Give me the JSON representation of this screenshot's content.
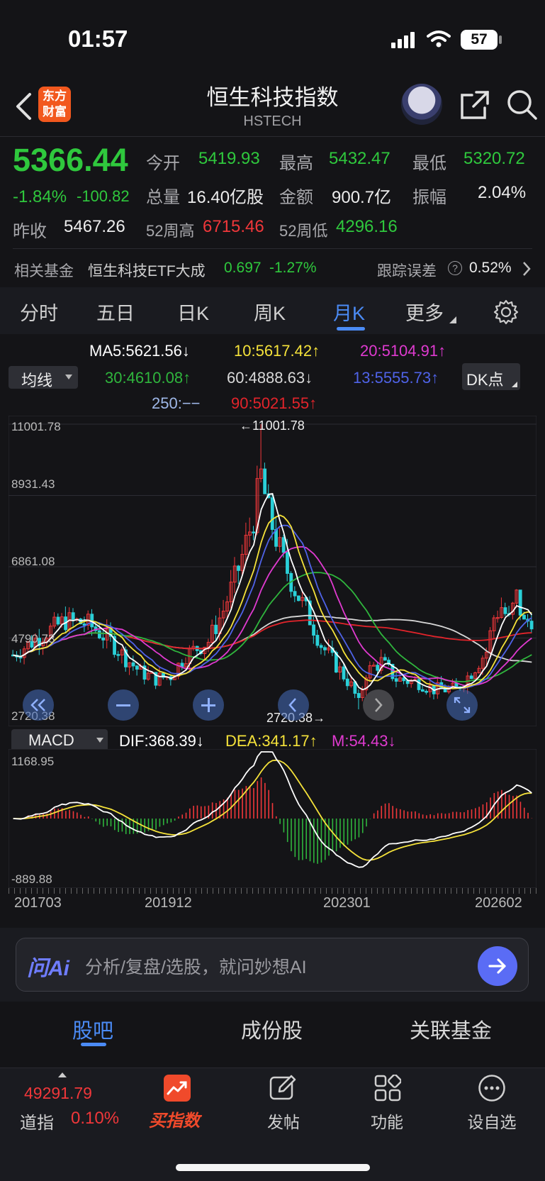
{
  "status_bar": {
    "time": "01:57",
    "battery": "57"
  },
  "header": {
    "logo_line1": "东方",
    "logo_line2": "财富",
    "title": "恒生科技指数",
    "subtitle": "HSTECH"
  },
  "quote": {
    "price": "5366.44",
    "change_pct": "-1.84%",
    "change": "-100.82",
    "open_label": "今开",
    "open": "5419.93",
    "high_label": "最高",
    "high": "5432.47",
    "low_label": "最低",
    "low": "5320.72",
    "volume_label": "总量",
    "volume": "16.40亿股",
    "amount_label": "金额",
    "amount": "900.7亿",
    "amplitude_label": "振幅",
    "amplitude": "2.04%",
    "prev_close_label": "昨收",
    "prev_close": "5467.26",
    "w52_high_label": "52周高",
    "w52_high": "6715.46",
    "w52_low_label": "52周低",
    "w52_low": "4296.16"
  },
  "fund": {
    "label": "相关基金",
    "name": "恒生科技ETF大成",
    "price": "0.697",
    "change": "-1.27%",
    "tracking_label": "跟踪误差",
    "tracking_value": "0.52%"
  },
  "tabs": [
    "分时",
    "五日",
    "日K",
    "周K",
    "月K",
    "更多"
  ],
  "ma_legend": {
    "ma5": "MA5:5621.56↓",
    "ma10": "10:5617.42↑",
    "ma20": "20:5104.91↑",
    "ma30": "30:4610.08↑",
    "ma60": "60:4888.63↓",
    "ma13": "13:5555.73↑",
    "ma250": "250:−−",
    "ma90": "90:5021.55↑",
    "indicator_btn": "均线",
    "dk_btn": "DK点"
  },
  "colors": {
    "ma5": "#ffffff",
    "ma10": "#f5e23a",
    "ma20": "#e03ad0",
    "ma30": "#2fb53d",
    "ma60": "#d8d8d8",
    "ma13": "#4f63e8",
    "ma250": "#9fb8e8",
    "ma90": "#e3242b",
    "up": "#f0373a",
    "down": "#2ad0d8",
    "accent": "#4b8bf5"
  },
  "kchart": {
    "y_labels": [
      "11001.78",
      "8931.43",
      "6861.08",
      "4790.73",
      "2720.38"
    ],
    "max_annotation": "←11001.78",
    "min_annotation": "2720.38→"
  },
  "macd": {
    "btn": "MACD",
    "dif": "DIF:368.39↓",
    "dea": "DEA:341.17↑",
    "m": "M:54.43↓",
    "y_top": "1168.95",
    "y_bottom": "-889.88",
    "x_labels": [
      "201703",
      "201912",
      "202301",
      "202602"
    ]
  },
  "ai": {
    "logo": "问Ai",
    "placeholder": "分析/复盘/选股，就问妙想AI"
  },
  "subtabs": [
    "股吧",
    "成份股",
    "关联基金"
  ],
  "bottom_nav": {
    "ticker_value": "49291.79",
    "ticker_name": "道指",
    "ticker_change": "0.10%",
    "buy": "买指数",
    "post": "发帖",
    "func": "功能",
    "watch": "设自选"
  },
  "chart_data": {
    "type": "candlestick",
    "title": "",
    "x_labels": [
      "201703",
      "201912",
      "202301",
      "202602"
    ],
    "ylim": [
      2720.38,
      11001.78
    ],
    "max_value": 11001.78,
    "min_value": 2720.38,
    "series_ma5_approx": [
      4350,
      4700,
      4950,
      4800,
      4400,
      4000,
      3800,
      3900,
      4300,
      5300,
      7200,
      8500,
      8300,
      6500,
      5200,
      4200,
      3600,
      3900,
      3700,
      3500,
      3400,
      3700,
      4500,
      5200,
      5700,
      5620
    ]
  }
}
